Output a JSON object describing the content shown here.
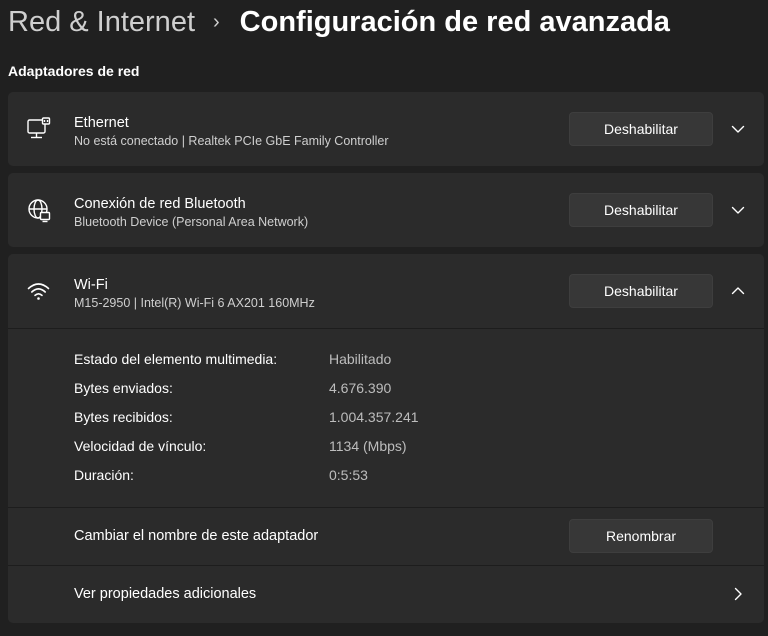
{
  "header": {
    "parent": "Red & Internet",
    "separator": "›",
    "title": "Configuración de red avanzada"
  },
  "section_title": "Adaptadores de red",
  "adapters": [
    {
      "icon": "ethernet-icon",
      "name": "Ethernet",
      "description": "No está conectado | Realtek PCIe GbE Family Controller",
      "button": "Deshabilitar",
      "expanded": false
    },
    {
      "icon": "globe-network-icon",
      "name": "Conexión de red Bluetooth",
      "description": "Bluetooth Device (Personal Area Network)",
      "button": "Deshabilitar",
      "expanded": false
    },
    {
      "icon": "wifi-icon",
      "name": "Wi-Fi",
      "description": "M15-2950 | Intel(R) Wi-Fi 6 AX201 160MHz",
      "button": "Deshabilitar",
      "expanded": true
    }
  ],
  "wifi_details": [
    {
      "label": "Estado del elemento multimedia:",
      "value": "Habilitado"
    },
    {
      "label": "Bytes enviados:",
      "value": "4.676.390"
    },
    {
      "label": "Bytes recibidos:",
      "value": "1.004.357.241"
    },
    {
      "label": "Velocidad de vínculo:",
      "value": "1134 (Mbps)"
    },
    {
      "label": "Duración:",
      "value": "0:5:53"
    }
  ],
  "rename": {
    "label": "Cambiar el nombre de este adaptador",
    "button": "Renombrar"
  },
  "more_properties": {
    "label": "Ver propiedades adicionales"
  },
  "colors": {
    "background": "#202020",
    "card": "#2b2b2b",
    "button": "#373737"
  }
}
